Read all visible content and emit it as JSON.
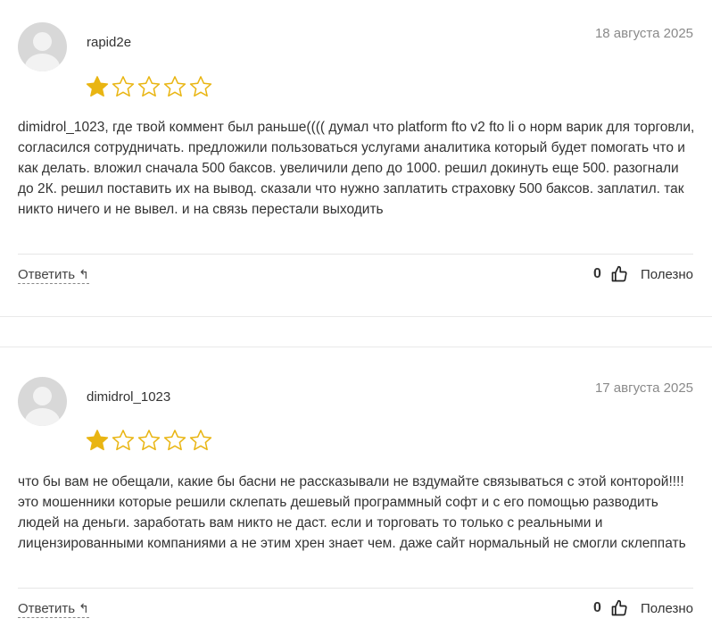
{
  "colors": {
    "star_filled": "#e9b512",
    "star_empty": "#e9b512",
    "date": "#8a8a8a"
  },
  "reviews": [
    {
      "author": "rapid2e",
      "date": "18 августа 2025",
      "rating": 1,
      "max_rating": 5,
      "text": "dimidrol_1023, где твой коммент был раньше(((( думал что platform fto v2 fto li о норм варик для торговли, согласился сотрудничать. предложили пользоваться услугами аналитика который будет помогать что и как делать. вложил сначала 500 баксов. увеличили депо до 1000. решил докинуть еще 500. разогнали до 2К. решил поставить их на вывод. сказали что нужно заплатить страховку 500 баксов. заплатил. так никто ничего и не вывел. и на связь перестали выходить",
      "reply_label": "Ответить",
      "vote_count": "0",
      "useful_label": "Полезно"
    },
    {
      "author": "dimidrol_1023",
      "date": "17 августа 2025",
      "rating": 1,
      "max_rating": 5,
      "text": "что бы вам не обещали, какие бы басни не рассказывали не вздумайте связываться с этой конторой!!!! это мошенники которые решили склепать дешевый программный софт и с его помощью разводить людей на деньги. заработать вам никто не даст. если и торговать то только с реальными и лицензированными компаниями а не этим хрен знает чем. даже сайт нормальный не смогли склеппать",
      "reply_label": "Ответить",
      "vote_count": "0",
      "useful_label": "Полезно"
    }
  ]
}
